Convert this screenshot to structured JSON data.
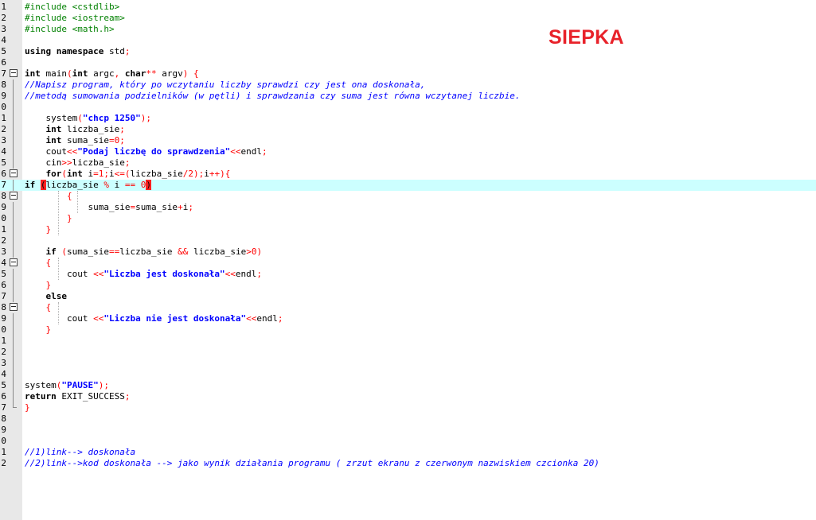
{
  "overlay": {
    "name_text": "SIEPKA",
    "color": "#e8222a"
  },
  "colors": {
    "highlight_line": "#ccffff",
    "gutter": "#e8e8e8",
    "preprocessor": "#008000",
    "comment": "#0000ff",
    "string": "#0000ff",
    "operator": "#ff0000",
    "brace_match": "#ff2020"
  },
  "lines": [
    {
      "num": "1",
      "fold": "",
      "tokens": [
        [
          "pp",
          "#include <cstdlib>"
        ]
      ]
    },
    {
      "num": "2",
      "fold": "",
      "tokens": [
        [
          "pp",
          "#include <iostream>"
        ]
      ]
    },
    {
      "num": "3",
      "fold": "",
      "tokens": [
        [
          "pp",
          "#include <math.h>"
        ]
      ]
    },
    {
      "num": "4",
      "fold": "",
      "tokens": []
    },
    {
      "num": "5",
      "fold": "",
      "tokens": [
        [
          "kw",
          "using namespace"
        ],
        [
          "tx",
          " std"
        ],
        [
          "op",
          ";"
        ]
      ]
    },
    {
      "num": "6",
      "fold": "",
      "tokens": []
    },
    {
      "num": "7",
      "fold": "box",
      "tokens": [
        [
          "kw",
          "int"
        ],
        [
          "tx",
          " main"
        ],
        [
          "op",
          "("
        ],
        [
          "kw",
          "int"
        ],
        [
          "tx",
          " argc"
        ],
        [
          "op",
          ","
        ],
        [
          "tx",
          " "
        ],
        [
          "kw",
          "char"
        ],
        [
          "op",
          "**"
        ],
        [
          "tx",
          " argv"
        ],
        [
          "op",
          ")"
        ],
        [
          "tx",
          " "
        ],
        [
          "op",
          "{"
        ]
      ]
    },
    {
      "num": "8",
      "fold": "line",
      "tokens": [
        [
          "cm",
          "//Napisz program, który po wczytaniu liczby sprawdzi czy jest ona doskonała,"
        ]
      ]
    },
    {
      "num": "9",
      "fold": "line",
      "tokens": [
        [
          "cm",
          "//metodą sumowania podzielników (w pętli) i sprawdzania czy suma jest równa wczytanej liczbie."
        ]
      ]
    },
    {
      "num": "0",
      "fold": "line",
      "tokens": []
    },
    {
      "num": "1",
      "fold": "line",
      "tokens": [
        [
          "tx",
          "    system"
        ],
        [
          "op",
          "("
        ],
        [
          "st",
          "\"chcp 1250\""
        ],
        [
          "op",
          ");"
        ]
      ]
    },
    {
      "num": "2",
      "fold": "line",
      "tokens": [
        [
          "tx",
          "    "
        ],
        [
          "kw",
          "int"
        ],
        [
          "tx",
          " liczba_sie"
        ],
        [
          "op",
          ";"
        ]
      ]
    },
    {
      "num": "3",
      "fold": "line",
      "tokens": [
        [
          "tx",
          "    "
        ],
        [
          "kw",
          "int"
        ],
        [
          "tx",
          " suma_sie"
        ],
        [
          "op",
          "="
        ],
        [
          "nm",
          "0"
        ],
        [
          "op",
          ";"
        ]
      ]
    },
    {
      "num": "4",
      "fold": "line",
      "tokens": [
        [
          "tx",
          "    cout"
        ],
        [
          "op",
          "<<"
        ],
        [
          "st",
          "\"Podaj liczbę do sprawdzenia\""
        ],
        [
          "op",
          "<<"
        ],
        [
          "tx",
          "endl"
        ],
        [
          "op",
          ";"
        ]
      ]
    },
    {
      "num": "5",
      "fold": "line",
      "tokens": [
        [
          "tx",
          "    cin"
        ],
        [
          "op",
          ">>"
        ],
        [
          "tx",
          "liczba_sie"
        ],
        [
          "op",
          ";"
        ]
      ]
    },
    {
      "num": "6",
      "fold": "box",
      "tokens": [
        [
          "tx",
          "    "
        ],
        [
          "kw",
          "for"
        ],
        [
          "op",
          "("
        ],
        [
          "kw",
          "int"
        ],
        [
          "tx",
          " i"
        ],
        [
          "op",
          "="
        ],
        [
          "nm",
          "1"
        ],
        [
          "op",
          ";"
        ],
        [
          "tx",
          "i"
        ],
        [
          "op",
          "<=("
        ],
        [
          "tx",
          "liczba_sie"
        ],
        [
          "op",
          "/"
        ],
        [
          "nm",
          "2"
        ],
        [
          "op",
          ");"
        ],
        [
          "tx",
          "i"
        ],
        [
          "op",
          "++){"
        ]
      ]
    },
    {
      "num": "7",
      "fold": "line",
      "highlight": true,
      "tokens": [
        [
          "kw",
          "if"
        ],
        [
          "tx",
          " "
        ],
        [
          "bm",
          "("
        ],
        [
          "tx",
          "liczba_sie "
        ],
        [
          "op",
          "%"
        ],
        [
          "tx",
          " i "
        ],
        [
          "op",
          "=="
        ],
        [
          "tx",
          " "
        ],
        [
          "nm",
          "0"
        ],
        [
          "bm",
          ")"
        ]
      ]
    },
    {
      "num": "8",
      "fold": "box",
      "tokens": [
        [
          "tx",
          "        "
        ],
        [
          "op",
          "{"
        ]
      ]
    },
    {
      "num": "9",
      "fold": "line",
      "tokens": [
        [
          "tx",
          "            suma_sie"
        ],
        [
          "op",
          "="
        ],
        [
          "tx",
          "suma_sie"
        ],
        [
          "op",
          "+"
        ],
        [
          "tx",
          "i"
        ],
        [
          "op",
          ";"
        ]
      ]
    },
    {
      "num": "0",
      "fold": "line",
      "tokens": [
        [
          "tx",
          "        "
        ],
        [
          "op",
          "}"
        ]
      ]
    },
    {
      "num": "1",
      "fold": "line",
      "tokens": [
        [
          "tx",
          "    "
        ],
        [
          "op",
          "}"
        ]
      ]
    },
    {
      "num": "2",
      "fold": "line",
      "tokens": []
    },
    {
      "num": "3",
      "fold": "line",
      "tokens": [
        [
          "tx",
          "    "
        ],
        [
          "kw",
          "if"
        ],
        [
          "tx",
          " "
        ],
        [
          "op",
          "("
        ],
        [
          "tx",
          "suma_sie"
        ],
        [
          "op",
          "=="
        ],
        [
          "tx",
          "liczba_sie "
        ],
        [
          "op",
          "&&"
        ],
        [
          "tx",
          " liczba_sie"
        ],
        [
          "op",
          ">"
        ],
        [
          "nm",
          "0"
        ],
        [
          "op",
          ")"
        ]
      ]
    },
    {
      "num": "4",
      "fold": "box",
      "tokens": [
        [
          "tx",
          "    "
        ],
        [
          "op",
          "{"
        ]
      ]
    },
    {
      "num": "5",
      "fold": "line",
      "tokens": [
        [
          "tx",
          "        cout "
        ],
        [
          "op",
          "<<"
        ],
        [
          "st",
          "\"Liczba jest doskonała\""
        ],
        [
          "op",
          "<<"
        ],
        [
          "tx",
          "endl"
        ],
        [
          "op",
          ";"
        ]
      ]
    },
    {
      "num": "6",
      "fold": "line",
      "tokens": [
        [
          "tx",
          "    "
        ],
        [
          "op",
          "}"
        ]
      ]
    },
    {
      "num": "7",
      "fold": "line",
      "tokens": [
        [
          "tx",
          "    "
        ],
        [
          "kw",
          "else"
        ]
      ]
    },
    {
      "num": "8",
      "fold": "box",
      "tokens": [
        [
          "tx",
          "    "
        ],
        [
          "op",
          "{"
        ]
      ]
    },
    {
      "num": "9",
      "fold": "line",
      "tokens": [
        [
          "tx",
          "        cout "
        ],
        [
          "op",
          "<<"
        ],
        [
          "st",
          "\"Liczba nie jest doskonała\""
        ],
        [
          "op",
          "<<"
        ],
        [
          "tx",
          "endl"
        ],
        [
          "op",
          ";"
        ]
      ]
    },
    {
      "num": "0",
      "fold": "line",
      "tokens": [
        [
          "tx",
          "    "
        ],
        [
          "op",
          "}"
        ]
      ]
    },
    {
      "num": "1",
      "fold": "line",
      "tokens": []
    },
    {
      "num": "2",
      "fold": "line",
      "tokens": []
    },
    {
      "num": "3",
      "fold": "line",
      "tokens": []
    },
    {
      "num": "4",
      "fold": "line",
      "tokens": []
    },
    {
      "num": "5",
      "fold": "line",
      "tokens": [
        [
          "tx",
          "system"
        ],
        [
          "op",
          "("
        ],
        [
          "st",
          "\"PAUSE\""
        ],
        [
          "op",
          ");"
        ]
      ]
    },
    {
      "num": "6",
      "fold": "line",
      "tokens": [
        [
          "kw",
          "return"
        ],
        [
          "tx",
          " EXIT_SUCCESS"
        ],
        [
          "op",
          ";"
        ]
      ]
    },
    {
      "num": "7",
      "fold": "end",
      "tokens": [
        [
          "op",
          "}"
        ]
      ]
    },
    {
      "num": "8",
      "fold": "",
      "tokens": []
    },
    {
      "num": "9",
      "fold": "",
      "tokens": []
    },
    {
      "num": "0",
      "fold": "",
      "tokens": []
    },
    {
      "num": "1",
      "fold": "",
      "tokens": [
        [
          "cm",
          "//1)link--> doskonała"
        ]
      ]
    },
    {
      "num": "2",
      "fold": "",
      "tokens": [
        [
          "cm",
          "//2)link-->kod doskonała --> jako wynik działania programu ( zrzut ekranu z czerwonym nazwiskiem czcionka 20)"
        ]
      ]
    }
  ]
}
